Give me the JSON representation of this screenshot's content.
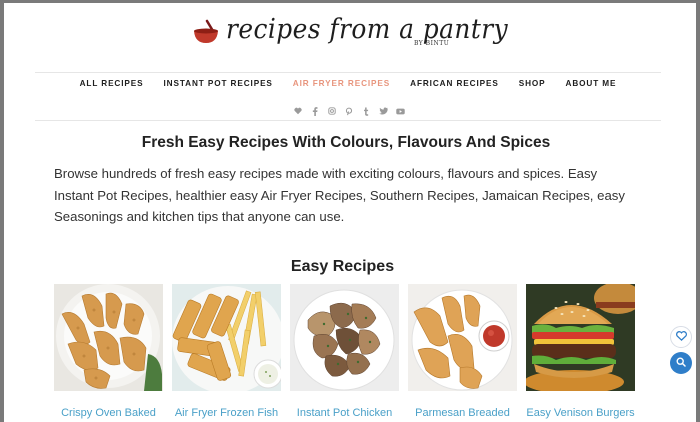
{
  "logo": {
    "brand": "recipes from a pantry",
    "byline": "BY BINTU"
  },
  "nav": {
    "items": [
      {
        "label": "ALL RECIPES"
      },
      {
        "label": "INSTANT POT RECIPES"
      },
      {
        "label": "AIR FRYER RECIPES",
        "active": true
      },
      {
        "label": "AFRICAN RECIPES"
      },
      {
        "label": "SHOP"
      },
      {
        "label": "ABOUT ME"
      }
    ]
  },
  "social": [
    "heart-icon",
    "facebook-icon",
    "instagram-icon",
    "pinterest-icon",
    "tumblr-icon",
    "twitter-icon",
    "youtube-icon"
  ],
  "main": {
    "headline": "Fresh Easy Recipes With Colours, Flavours And Spices",
    "intro": "Browse hundreds of fresh easy recipes made with exciting colours, flavours and spices. Easy Instant Pot Recipes, healthier easy Air Fryer Recipes, Southern Recipes, Jamaican Recipes, easy Seasonings and kitchen tips that anyone can use.",
    "section_title": "Easy Recipes",
    "cards": [
      {
        "title": "Crispy Oven Baked"
      },
      {
        "title": "Air Fryer Frozen Fish"
      },
      {
        "title": "Instant Pot Chicken"
      },
      {
        "title": "Parmesan Breaded"
      },
      {
        "title": "Easy Venison Burgers"
      }
    ]
  },
  "colors": {
    "accent": "#e8957d",
    "link": "#4aa0c8",
    "float_button": "#2f7ec9"
  },
  "floating": {
    "favorite": "heart-icon",
    "search": "search-icon"
  }
}
